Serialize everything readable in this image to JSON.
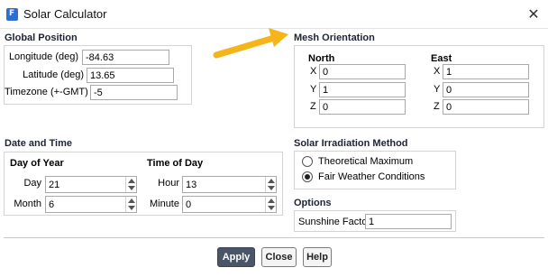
{
  "window": {
    "title": "Solar Calculator"
  },
  "global_position": {
    "title": "Global Position",
    "longitude_label": "Longitude (deg)",
    "longitude_value": "-84.63",
    "latitude_label": "Latitude (deg)",
    "latitude_value": "13.65",
    "timezone_label": "Timezone (+-GMT)",
    "timezone_value": "-5"
  },
  "mesh_orientation": {
    "title": "Mesh Orientation",
    "north": {
      "title": "North",
      "x_label": "X",
      "x": "0",
      "y_label": "Y",
      "y": "1",
      "z_label": "Z",
      "z": "0"
    },
    "east": {
      "title": "East",
      "x_label": "X",
      "x": "1",
      "y_label": "Y",
      "y": "0",
      "z_label": "Z",
      "z": "0"
    }
  },
  "date_time": {
    "title": "Date and Time",
    "day_of_year": {
      "title": "Day of Year",
      "day_label": "Day",
      "day": "21",
      "month_label": "Month",
      "month": "6"
    },
    "time_of_day": {
      "title": "Time of Day",
      "hour_label": "Hour",
      "hour": "13",
      "minute_label": "Minute",
      "minute": "0"
    }
  },
  "irradiation": {
    "title": "Solar Irradiation Method",
    "options": [
      "Theoretical Maximum",
      "Fair Weather Conditions"
    ],
    "selected": "Fair Weather Conditions"
  },
  "options": {
    "title": "Options",
    "sunshine_label": "Sunshine Factor",
    "sunshine_value": "1"
  },
  "buttons": {
    "apply": "Apply",
    "close": "Close",
    "help": "Help"
  },
  "colors": {
    "annotation_arrow": "#f5b417",
    "primary_button": "#4a5668"
  }
}
